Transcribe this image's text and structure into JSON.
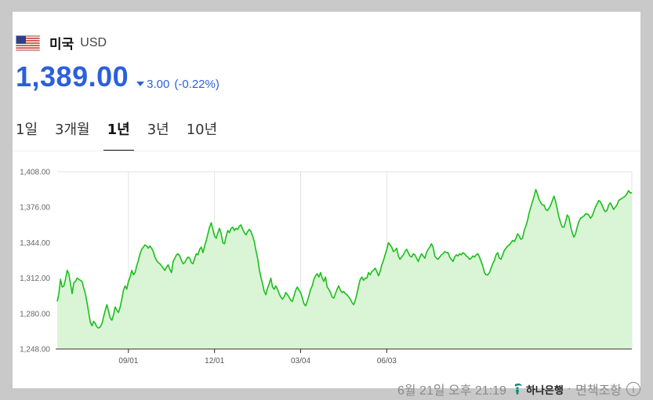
{
  "header": {
    "country": "미국",
    "currency": "USD"
  },
  "quote": {
    "price": "1,389.00",
    "direction": "down",
    "change": "3.00",
    "change_pct": "(-0.22%)",
    "color": "#2b5fdc"
  },
  "tabs": [
    {
      "label": "1일",
      "active": false
    },
    {
      "label": "3개월",
      "active": false
    },
    {
      "label": "1년",
      "active": true
    },
    {
      "label": "3년",
      "active": false
    },
    {
      "label": "10년",
      "active": false
    }
  ],
  "footer": {
    "timestamp": "6월 21일 오후 21:19",
    "bank": "하나은행",
    "disclaimer": "면책조항"
  },
  "chart_data": {
    "type": "area",
    "ylim": [
      1248,
      1408
    ],
    "yticks": [
      1248,
      1280,
      1312,
      1344,
      1376,
      1408
    ],
    "ytick_labels": [
      "1,248.00",
      "1,280.00",
      "1,312.00",
      "1,344.00",
      "1,376.00",
      "1,408.00"
    ],
    "xticks": [
      {
        "label": "09/01",
        "index": 43
      },
      {
        "label": "12/01",
        "index": 95
      },
      {
        "label": "03/04",
        "index": 147
      },
      {
        "label": "06/03",
        "index": 199
      }
    ],
    "grid": true,
    "line_color": "#19c019",
    "fill_color": "#d9f5d6",
    "values": [
      1291,
      1298,
      1311,
      1304,
      1305,
      1311,
      1319,
      1316,
      1307,
      1298,
      1308,
      1309,
      1312,
      1311,
      1310,
      1309,
      1303,
      1298,
      1290,
      1281,
      1272,
      1269,
      1273,
      1271,
      1268,
      1267,
      1268,
      1271,
      1277,
      1283,
      1288,
      1282,
      1276,
      1274,
      1279,
      1286,
      1283,
      1281,
      1286,
      1293,
      1301,
      1305,
      1302,
      1309,
      1313,
      1319,
      1315,
      1317,
      1323,
      1328,
      1334,
      1338,
      1340,
      1342,
      1341,
      1339,
      1341,
      1339,
      1336,
      1331,
      1328,
      1326,
      1325,
      1323,
      1321,
      1319,
      1322,
      1324,
      1320,
      1317,
      1327,
      1330,
      1333,
      1334,
      1332,
      1328,
      1325,
      1326,
      1329,
      1331,
      1330,
      1326,
      1325,
      1330,
      1334,
      1333,
      1338,
      1340,
      1335,
      1341,
      1346,
      1352,
      1358,
      1362,
      1356,
      1350,
      1348,
      1353,
      1357,
      1352,
      1344,
      1343,
      1350,
      1355,
      1353,
      1357,
      1358,
      1355,
      1357,
      1356,
      1359,
      1360,
      1356,
      1353,
      1351,
      1354,
      1356,
      1354,
      1350,
      1345,
      1337,
      1330,
      1320,
      1313,
      1307,
      1300,
      1297,
      1303,
      1307,
      1312,
      1304,
      1302,
      1305,
      1302,
      1298,
      1295,
      1293,
      1295,
      1299,
      1297,
      1295,
      1292,
      1291,
      1296,
      1301,
      1304,
      1301,
      1299,
      1294,
      1289,
      1287,
      1291,
      1296,
      1302,
      1305,
      1311,
      1314,
      1316,
      1313,
      1317,
      1312,
      1309,
      1313,
      1304,
      1302,
      1299,
      1295,
      1294,
      1298,
      1302,
      1305,
      1301,
      1299,
      1300,
      1298,
      1297,
      1295,
      1293,
      1290,
      1288,
      1292,
      1298,
      1305,
      1311,
      1313,
      1310,
      1312,
      1312,
      1317,
      1315,
      1318,
      1319,
      1321,
      1318,
      1314,
      1318,
      1324,
      1328,
      1333,
      1338,
      1344,
      1342,
      1340,
      1336,
      1337,
      1339,
      1332,
      1329,
      1331,
      1333,
      1336,
      1338,
      1335,
      1332,
      1331,
      1334,
      1333,
      1330,
      1327,
      1331,
      1334,
      1332,
      1330,
      1335,
      1338,
      1340,
      1343,
      1340,
      1332,
      1330,
      1329,
      1331,
      1333,
      1334,
      1336,
      1335,
      1335,
      1331,
      1329,
      1327,
      1331,
      1333,
      1332,
      1334,
      1333,
      1335,
      1334,
      1332,
      1331,
      1329,
      1330,
      1332,
      1331,
      1333,
      1334,
      1331,
      1327,
      1323,
      1317,
      1315,
      1315,
      1317,
      1321,
      1325,
      1328,
      1333,
      1335,
      1330,
      1329,
      1333,
      1337,
      1339,
      1341,
      1342,
      1344,
      1346,
      1345,
      1348,
      1352,
      1350,
      1347,
      1348,
      1355,
      1359,
      1364,
      1371,
      1376,
      1381,
      1386,
      1392,
      1388,
      1383,
      1380,
      1378,
      1378,
      1374,
      1373,
      1375,
      1378,
      1382,
      1386,
      1381,
      1374,
      1367,
      1362,
      1358,
      1358,
      1363,
      1369,
      1367,
      1359,
      1353,
      1349,
      1352,
      1358,
      1363,
      1366,
      1367,
      1368,
      1370,
      1370,
      1369,
      1366,
      1368,
      1372,
      1376,
      1379,
      1382,
      1381,
      1378,
      1374,
      1372,
      1373,
      1378,
      1380,
      1377,
      1374,
      1376,
      1378,
      1382,
      1383,
      1384,
      1385,
      1386,
      1388,
      1391,
      1389,
      1389
    ]
  }
}
